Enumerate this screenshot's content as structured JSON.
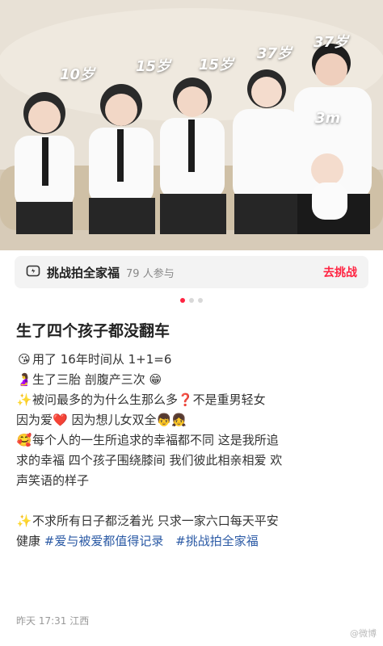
{
  "photo": {
    "ages": [
      "10岁",
      "15岁",
      "15岁",
      "37岁",
      "37岁",
      "3m"
    ]
  },
  "challenge": {
    "icon": "camera-challenge-icon",
    "title": "挑战拍全家福",
    "count": "79 人参与",
    "action": "去挑战"
  },
  "carousel": {
    "total": 3,
    "active": 1
  },
  "post": {
    "title": "生了四个孩子都没翻车",
    "lines": [
      {
        "emoji": "😘",
        "text": "用了 16年时间从 1+1=6"
      },
      {
        "emoji": "🤰",
        "text": "生了三胎 剖腹产三次 😁"
      },
      {
        "emoji": "✨",
        "text": "被问最多的为什么生那么多❓不是重男轻女"
      },
      {
        "emoji": "",
        "text": "因为爱❤️ 因为想儿女双全👦👧"
      },
      {
        "emoji": "🥰",
        "text": "每个人的一生所追求的幸福都不同 这是我所追"
      },
      {
        "emoji": "",
        "text": "求的幸福 四个孩子围绕膝间 我们彼此相亲相爱 欢"
      },
      {
        "emoji": "",
        "text": "声笑语的样子"
      }
    ],
    "line2": {
      "emoji": "✨",
      "text": "不求所有日子都泛着光 只求一家六口每天平安"
    },
    "line3_prefix": "健康",
    "tags": [
      "#爱与被爱都值得记录",
      "#挑战拍全家福"
    ]
  },
  "meta": {
    "time": "昨天 17:31 江西"
  },
  "watermark": "@微博"
}
